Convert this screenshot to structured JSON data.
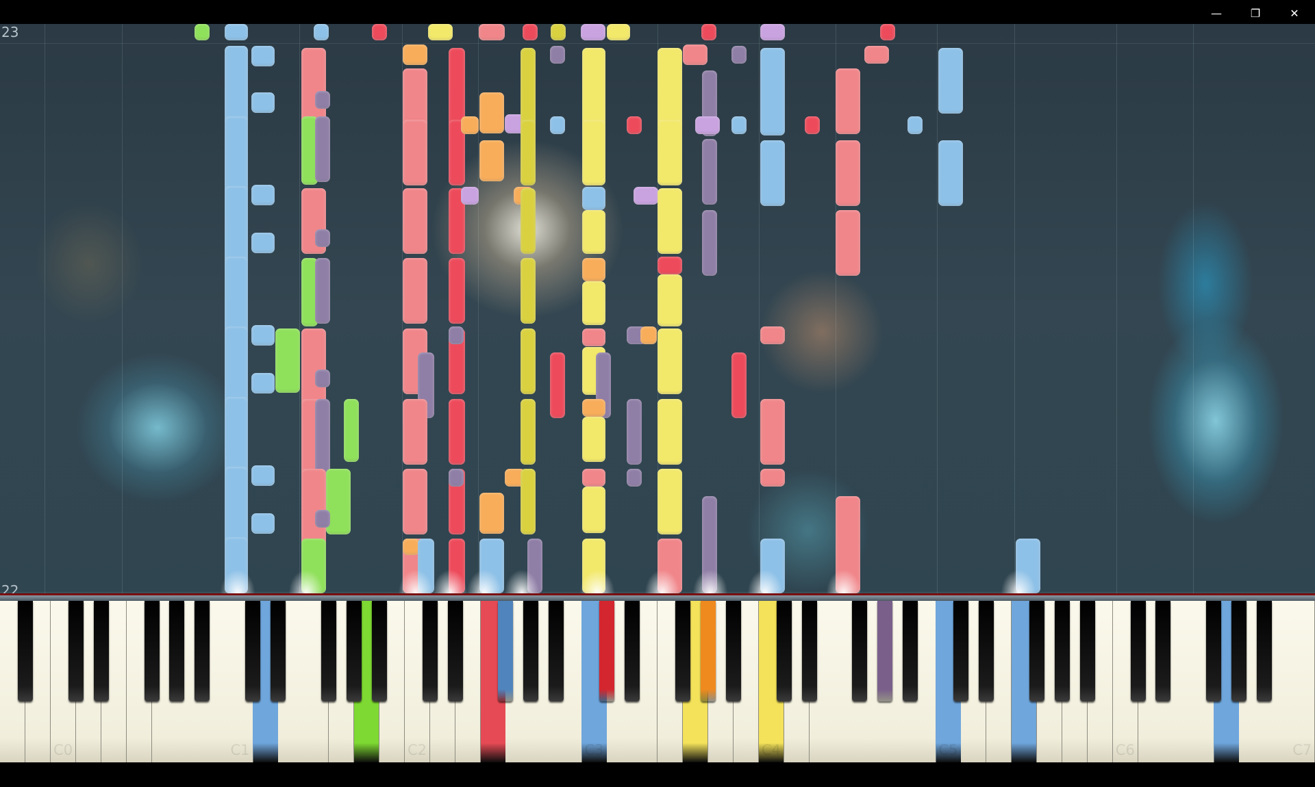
{
  "window": {
    "controls": [
      {
        "name": "minimize-button",
        "icon": "minimize-icon",
        "glyph": "—"
      },
      {
        "name": "restore-button",
        "icon": "restore-icon",
        "glyph": "❐"
      },
      {
        "name": "close-button",
        "icon": "close-icon",
        "glyph": "✕"
      }
    ]
  },
  "roll": {
    "measure_top": "23",
    "measure_bottom": "22",
    "colors": {
      "blue": "#8ec1e7",
      "green": "#8fe05a",
      "salmon": "#f0868a",
      "red": "#ed4b5b",
      "orange": "#f8ad5a",
      "yellow": "#f2e86a",
      "gold": "#d9d140",
      "purple": "#8f7ea6",
      "lavender": "#c9a2e0"
    }
  },
  "keyboard": {
    "octave_labels": [
      "C0",
      "C1",
      "C2",
      "C3",
      "C4",
      "C5",
      "C6",
      "C7"
    ],
    "pressed_colors": {
      "blue": "#6fa6dc",
      "green": "#7ed932",
      "red": "#e64b55",
      "orange": "#ef8a1f",
      "yellow": "#f3e25a",
      "purple": "#7a5f8a",
      "red_black": "#d4262e",
      "blue_black": "#4f84bd"
    }
  }
}
